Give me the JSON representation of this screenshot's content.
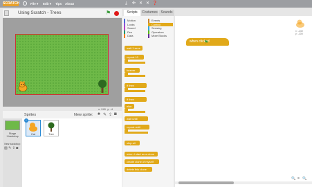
{
  "menubar": {
    "logo": "SCRATCH",
    "file": "File ▾",
    "edit": "Edit ▾",
    "tips": "Tips",
    "about": "About"
  },
  "stage": {
    "title": "Using Scratch - Trees",
    "coords_x": "x: 240",
    "coords_y": "y: -4"
  },
  "sprites": {
    "title": "Sprites",
    "new_sprite": "New sprite:",
    "stage_label": "Stage",
    "stage_sub": "1 backdrop",
    "new_backdrop": "New backdrop:",
    "items": [
      {
        "name": "Cat"
      },
      {
        "name": "Tree"
      }
    ]
  },
  "tabs": [
    "Scripts",
    "Costumes",
    "Sounds"
  ],
  "palette": {
    "categories_left": [
      "Motion",
      "Looks",
      "Sound",
      "Pen",
      "Data"
    ],
    "categories_right": [
      "Events",
      "Control",
      "Sensing",
      "Operators",
      "More Blocks"
    ],
    "blocks": [
      "wait 1 secs",
      "repeat 10",
      "forever",
      "if then",
      "if then",
      "else",
      "wait until",
      "repeat until",
      "stop all",
      "when I start as a clone",
      "create clone of myself",
      "delete this clone"
    ]
  },
  "scripts": {
    "hat_block": "when  clicked",
    "sprite_x": "x: -140",
    "sprite_y": "y: -100"
  }
}
